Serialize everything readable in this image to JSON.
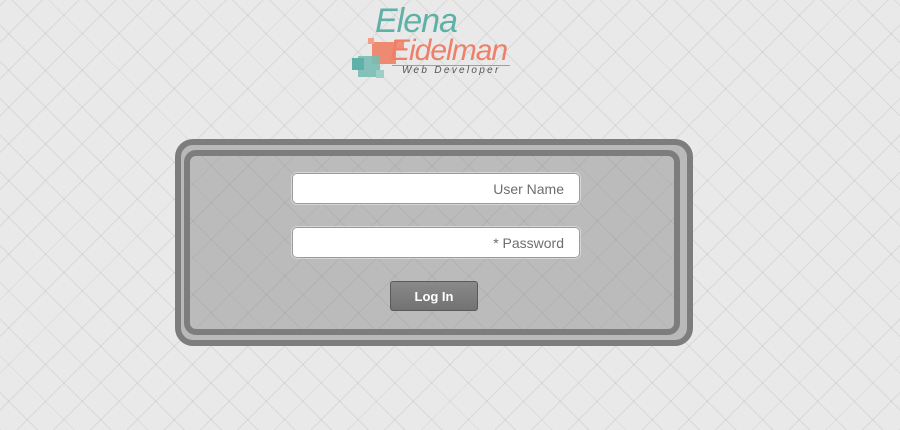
{
  "logo": {
    "first_name": "Elena",
    "last_name": "Eidelman",
    "tagline": "Web Developer",
    "colors": {
      "teal": "#5fb1a7",
      "coral": "#ee7f68"
    }
  },
  "login": {
    "username_placeholder": "User Name",
    "password_placeholder": "* Password",
    "login_label": "Log In"
  }
}
